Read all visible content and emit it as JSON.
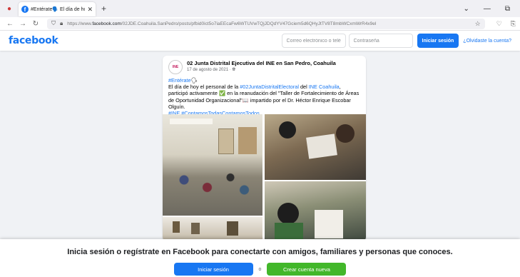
{
  "browser": {
    "tab_title": "#Entérate🗣️ El día de hoy el p",
    "url_prefix": "https://www.",
    "url_domain": "facebook.com",
    "url_rest": "/02JDE.Coahuila.SanPedro/posts/pfbid0ict5o7iaEEcaFw6WTUVwTQjJDQdYV47Gciem5d6QHyJtTV8T8mbWCxmWrR4x9el"
  },
  "fb_header": {
    "logo": "facebook",
    "email_placeholder": "Correo electrónico o teléfono",
    "password_placeholder": "Contraseña",
    "login_label": "Iniciar sesión",
    "forgot_label": "¿Olvidaste la cuenta?"
  },
  "post": {
    "page_name": "02 Junta Distrital Ejecutiva del INE en San Pedro, Coahuila",
    "avatar_text": "INE",
    "date": "17 de agosto de 2021",
    "audience_icon": "globe-icon",
    "line1_tag": "#Entérate",
    "line2_pre": "El día de hoy el personal de la ",
    "line2_tag": "#02JuntaDistritalElectoral",
    "line2_mid": " del ",
    "line2_tag2": "INE Coahuila",
    "line2_post": ", participó activamente ",
    "line2_post2": " en la reanudación del \"Taller de Fortalecimiento de Áreas de Oportunidad Organizacional\"",
    "line2_post3": " impartido por el Dr. Héctor Enrique Escobar Olguín.",
    "hashtags": "#INE #ContamosTodasContamosTodos"
  },
  "banner": {
    "text": "Inicia sesión o regístrate en Facebook para conectarte con amigos, familiares y personas que conoces.",
    "login_label": "Iniciar sesión",
    "or_label": "o",
    "create_label": "Crear cuenta nueva"
  },
  "colors": {
    "brand": "#1877f2",
    "create": "#42b72a"
  }
}
